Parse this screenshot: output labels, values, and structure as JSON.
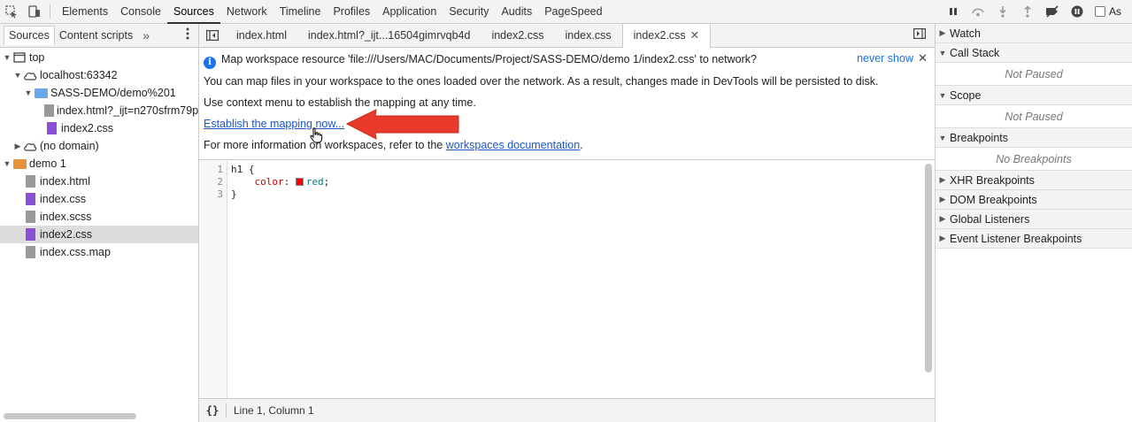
{
  "toolbar": {
    "tabs": [
      "Elements",
      "Console",
      "Sources",
      "Network",
      "Timeline",
      "Profiles",
      "Application",
      "Security",
      "Audits",
      "PageSpeed"
    ],
    "active_tab": "Sources"
  },
  "navigator": {
    "tabs": [
      "Sources",
      "Content scripts"
    ],
    "more": "»",
    "tree": [
      {
        "label": "top"
      },
      {
        "label": "localhost:63342"
      },
      {
        "label": "SASS-DEMO/demo%201"
      },
      {
        "label": "index.html?_ijt=n270sfrm79p"
      },
      {
        "label": "index2.css"
      },
      {
        "label": "(no domain)"
      },
      {
        "label": "demo 1"
      },
      {
        "label": "index.html"
      },
      {
        "label": "index.css"
      },
      {
        "label": "index.scss"
      },
      {
        "label": "index2.css"
      },
      {
        "label": "index.css.map"
      }
    ]
  },
  "editor": {
    "tabs": [
      "index.html",
      "index.html?_ijt...16504gimrvqb4d",
      "index2.css",
      "index.css",
      "index2.css"
    ],
    "active_tab_index": 4,
    "infobar": {
      "message": "Map workspace resource 'file:///Users/MAC/Documents/Project/SASS-DEMO/demo 1/index2.css' to network?",
      "never_show": "never show",
      "line1": "You can map files in your workspace to the ones loaded over the network. As a result, changes made in DevTools will be persisted to disk.",
      "line2": "Use context menu to establish the mapping at any time.",
      "establish_link": "Establish the mapping now...",
      "line4_prefix": "For more information on workspaces, refer to the ",
      "docs_link": "workspaces documentation",
      "line4_suffix": "."
    },
    "code": {
      "line_numbers": [
        "1",
        "2",
        "3"
      ],
      "line1": "h1 {",
      "prop": "color",
      "colon": ": ",
      "value": "red",
      "semicolon": ";",
      "line3": "}",
      "swatch_color": "#ff0000"
    },
    "status": {
      "pretty_print": "{}",
      "position": "Line 1, Column 1"
    }
  },
  "sidebar": {
    "async_label": "As",
    "panes": {
      "watch": "Watch",
      "call_stack": "Call Stack",
      "call_stack_body": "Not Paused",
      "scope": "Scope",
      "scope_body": "Not Paused",
      "breakpoints": "Breakpoints",
      "breakpoints_body": "No Breakpoints",
      "xhr": "XHR Breakpoints",
      "dom": "DOM Breakpoints",
      "global": "Global Listeners",
      "event": "Event Listener Breakpoints"
    }
  },
  "annotation_color": "#e8392a"
}
